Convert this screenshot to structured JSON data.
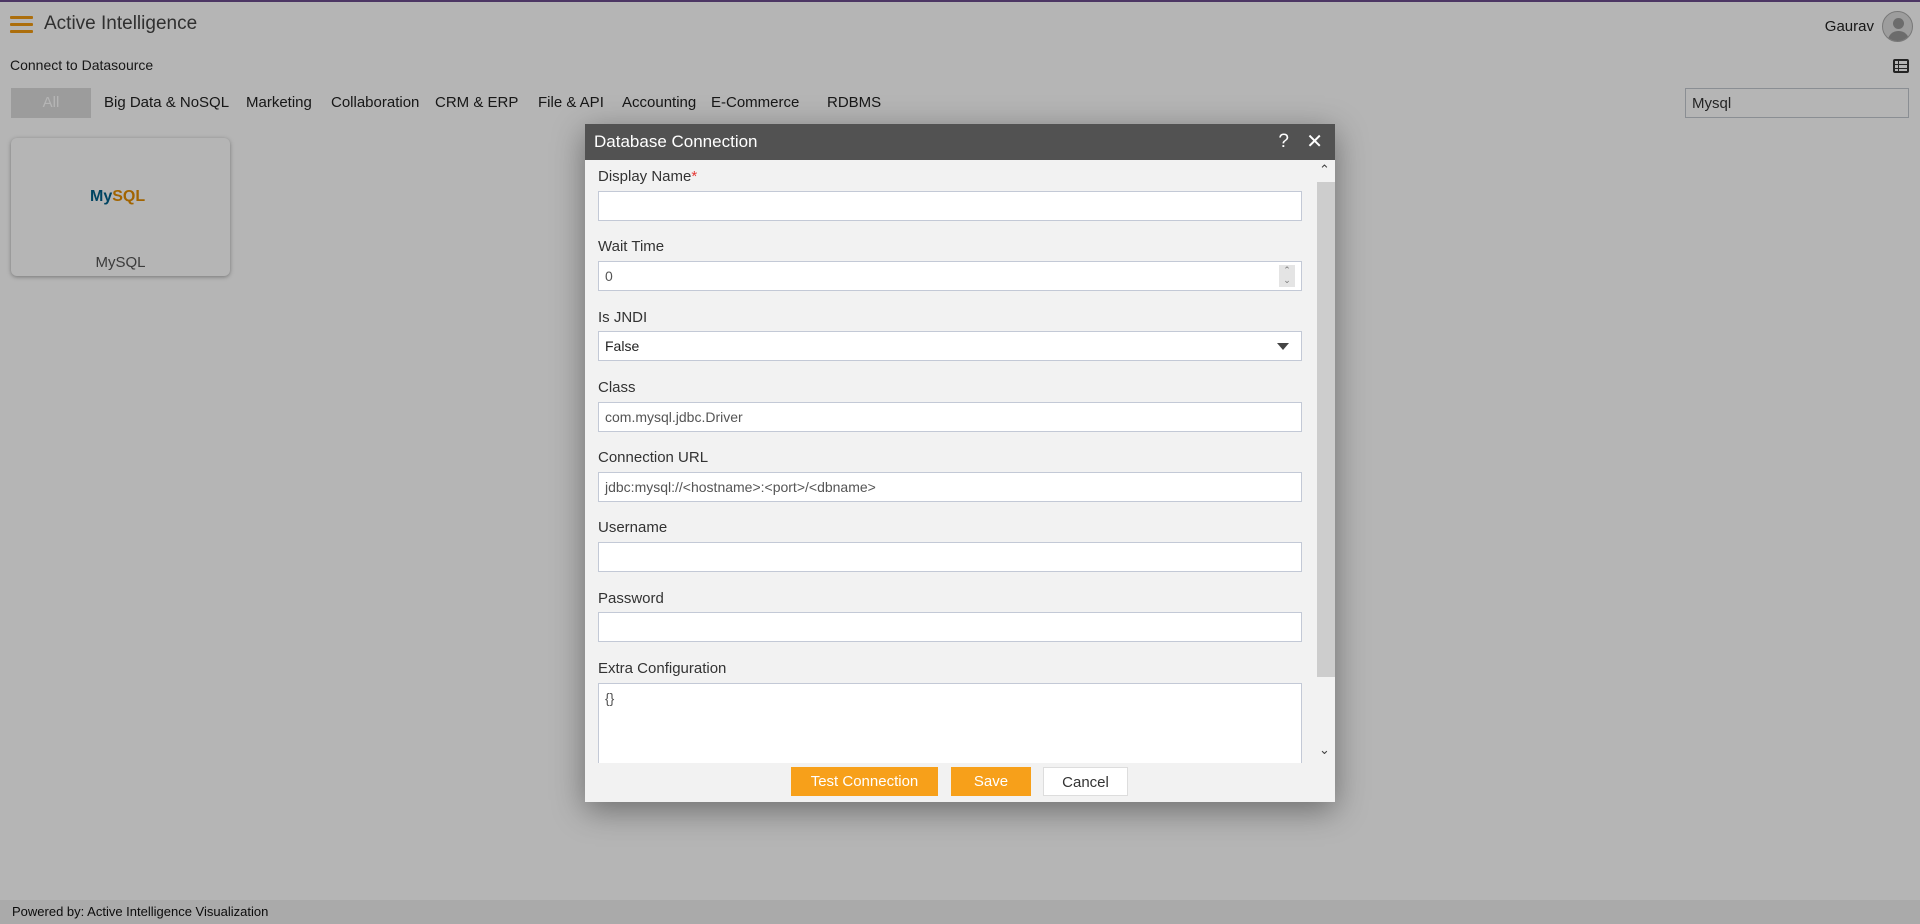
{
  "header": {
    "app_title": "Active Intelligence",
    "user_name": "Gaurav",
    "menu_icon": "hamburger-icon",
    "avatar_icon": "user-avatar-icon"
  },
  "subheader": {
    "title": "Connect to Datasource",
    "view_icon": "table-icon"
  },
  "tabs": [
    {
      "label": "All",
      "active": true
    },
    {
      "label": "Big Data & NoSQL"
    },
    {
      "label": "Marketing"
    },
    {
      "label": "Collaboration"
    },
    {
      "label": "CRM & ERP"
    },
    {
      "label": "File & API"
    },
    {
      "label": "Accounting"
    },
    {
      "label": "E-Commerce"
    },
    {
      "label": "RDBMS"
    }
  ],
  "search": {
    "value": "Mysql"
  },
  "datasources": [
    {
      "name": "MySQL",
      "logo_my": "My",
      "logo_sql": "SQL"
    }
  ],
  "footer": {
    "text": "Powered by: Active Intelligence Visualization"
  },
  "dialog": {
    "title": "Database Connection",
    "help": "?",
    "close": "✕",
    "fields": [
      {
        "label": "Display Name",
        "required_mark": "*",
        "value": ""
      },
      {
        "label": "Wait Time",
        "value": "0"
      },
      {
        "label": "Is JNDI",
        "value": "False"
      },
      {
        "label": "Class",
        "value": "com.mysql.jdbc.Driver"
      },
      {
        "label": "Connection URL",
        "value": "jdbc:mysql://<hostname>:<port>/<dbname>"
      },
      {
        "label": "Username",
        "value": ""
      },
      {
        "label": "Password",
        "value": ""
      },
      {
        "label": "Extra Configuration",
        "value": "{}"
      }
    ],
    "buttons": {
      "test": "Test Connection",
      "save": "Save",
      "cancel": "Cancel"
    }
  },
  "colors": {
    "accent": "#f7a01a",
    "dialog_header": "#525252",
    "brand_line": "#6b4c8e"
  }
}
